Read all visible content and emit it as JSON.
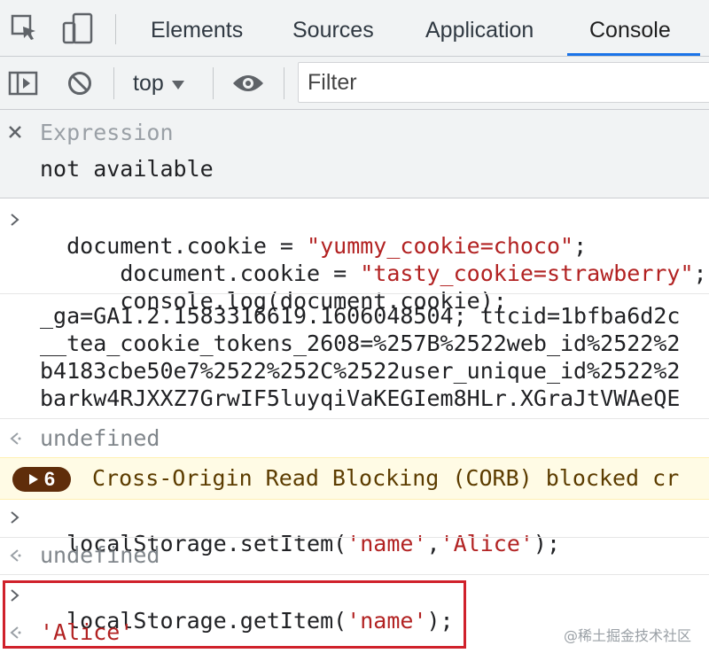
{
  "tabs": [
    {
      "label": "Elements"
    },
    {
      "label": "Sources"
    },
    {
      "label": "Application"
    },
    {
      "label": "Console"
    }
  ],
  "active_tab": "Console",
  "toolbar": {
    "context": "top",
    "filter_placeholder": "Filter"
  },
  "live_expression": {
    "label": "Expression",
    "value": "not available"
  },
  "console": {
    "entry1": {
      "line1_code": "document.cookie = ",
      "line1_str": "\"yummy_cookie=choco\"",
      "line1_end": ";",
      "line2_code": "    document.cookie = ",
      "line2_str": "\"tasty_cookie=strawberry\"",
      "line2_end": ";",
      "line3_code": "    console.log(document.cookie);"
    },
    "log_output": [
      "_ga=GA1.2.1583316619.1606048504; ttcid=1bfba6d2c",
      "__tea_cookie_tokens_2608=%257B%2522web_id%2522%2",
      "b4183cbe50e7%2522%252C%2522user_unique_id%2522%2",
      "barkw4RJXXZ7GrwIF5luyqiVaKEGIem8HLr.XGraJtVWAeQE"
    ],
    "result1": "undefined",
    "warning": {
      "count": "6",
      "text": "Cross-Origin Read Blocking (CORB) blocked cr"
    },
    "entry2": {
      "code_start": "localStorage.setItem(",
      "str1": "'name'",
      "sep": ",",
      "str2": "'Alice'",
      "code_end": ");"
    },
    "result2": "undefined",
    "entry3": {
      "code_start": "localStorage.getItem(",
      "str1": "'name'",
      "code_end": ");"
    },
    "result3": "'Alice'"
  },
  "watermark": "@稀土掘金技术社区",
  "colors": {
    "accent": "#1a73e8",
    "string": "#b22222",
    "highlight": "#d0212b",
    "warning_bg": "#fffbe5"
  }
}
